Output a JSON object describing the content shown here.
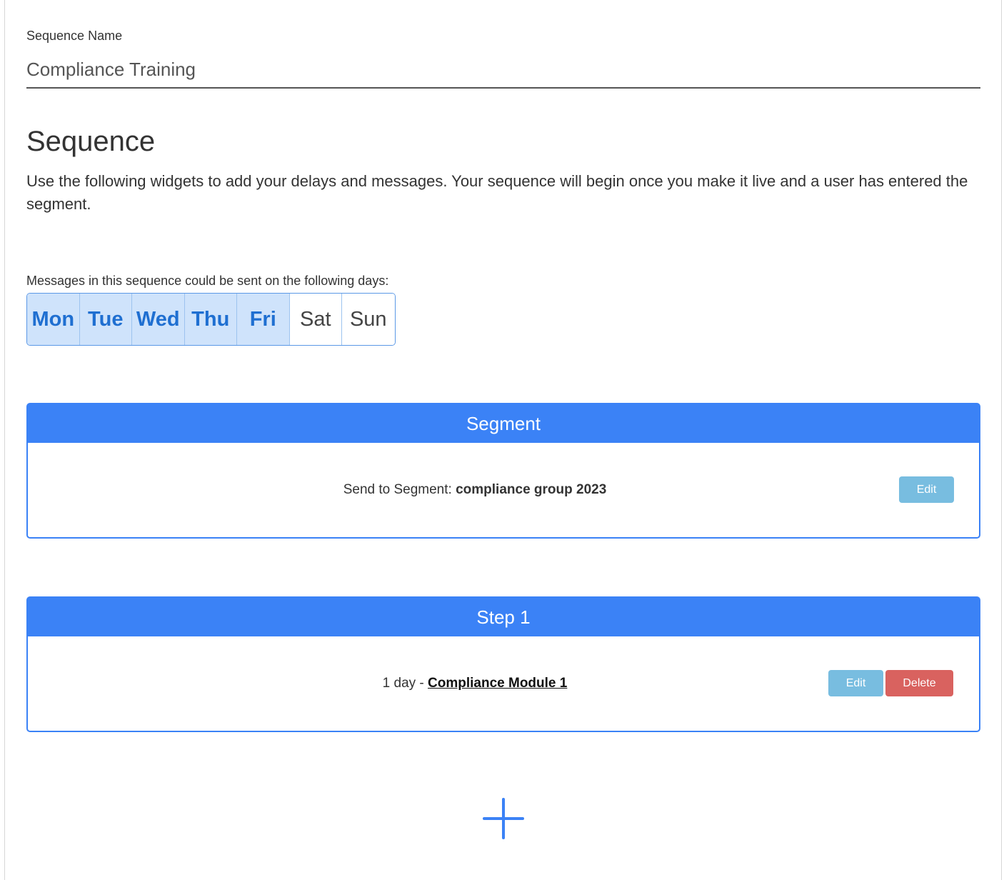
{
  "sequence_name": {
    "label": "Sequence Name",
    "value": "Compliance Training"
  },
  "sequence": {
    "title": "Sequence",
    "description": "Use the following widgets to add your delays and messages. Your sequence will begin once you make it live and a user has entered the segment."
  },
  "days": {
    "label": "Messages in this sequence could be sent on the following days:",
    "items": [
      {
        "label": "Mon",
        "selected": true
      },
      {
        "label": "Tue",
        "selected": true
      },
      {
        "label": "Wed",
        "selected": true
      },
      {
        "label": "Thu",
        "selected": true
      },
      {
        "label": "Fri",
        "selected": true
      },
      {
        "label": "Sat",
        "selected": false
      },
      {
        "label": "Sun",
        "selected": false
      }
    ]
  },
  "segment_card": {
    "title": "Segment",
    "prefix": "Send to Segment: ",
    "segment_name": "compliance group 2023",
    "edit_label": "Edit"
  },
  "step_card": {
    "title": "Step 1",
    "delay": "1 day - ",
    "message_link": "Compliance Module 1",
    "edit_label": "Edit",
    "delete_label": "Delete"
  },
  "add_step": {
    "icon": "plus-icon"
  },
  "colors": {
    "accent": "#3b82f6",
    "day_selected_bg": "#cfe3fb",
    "day_selected_text": "#1f6fd1",
    "edit_button": "#78bde0",
    "delete_button": "#d9625f"
  }
}
